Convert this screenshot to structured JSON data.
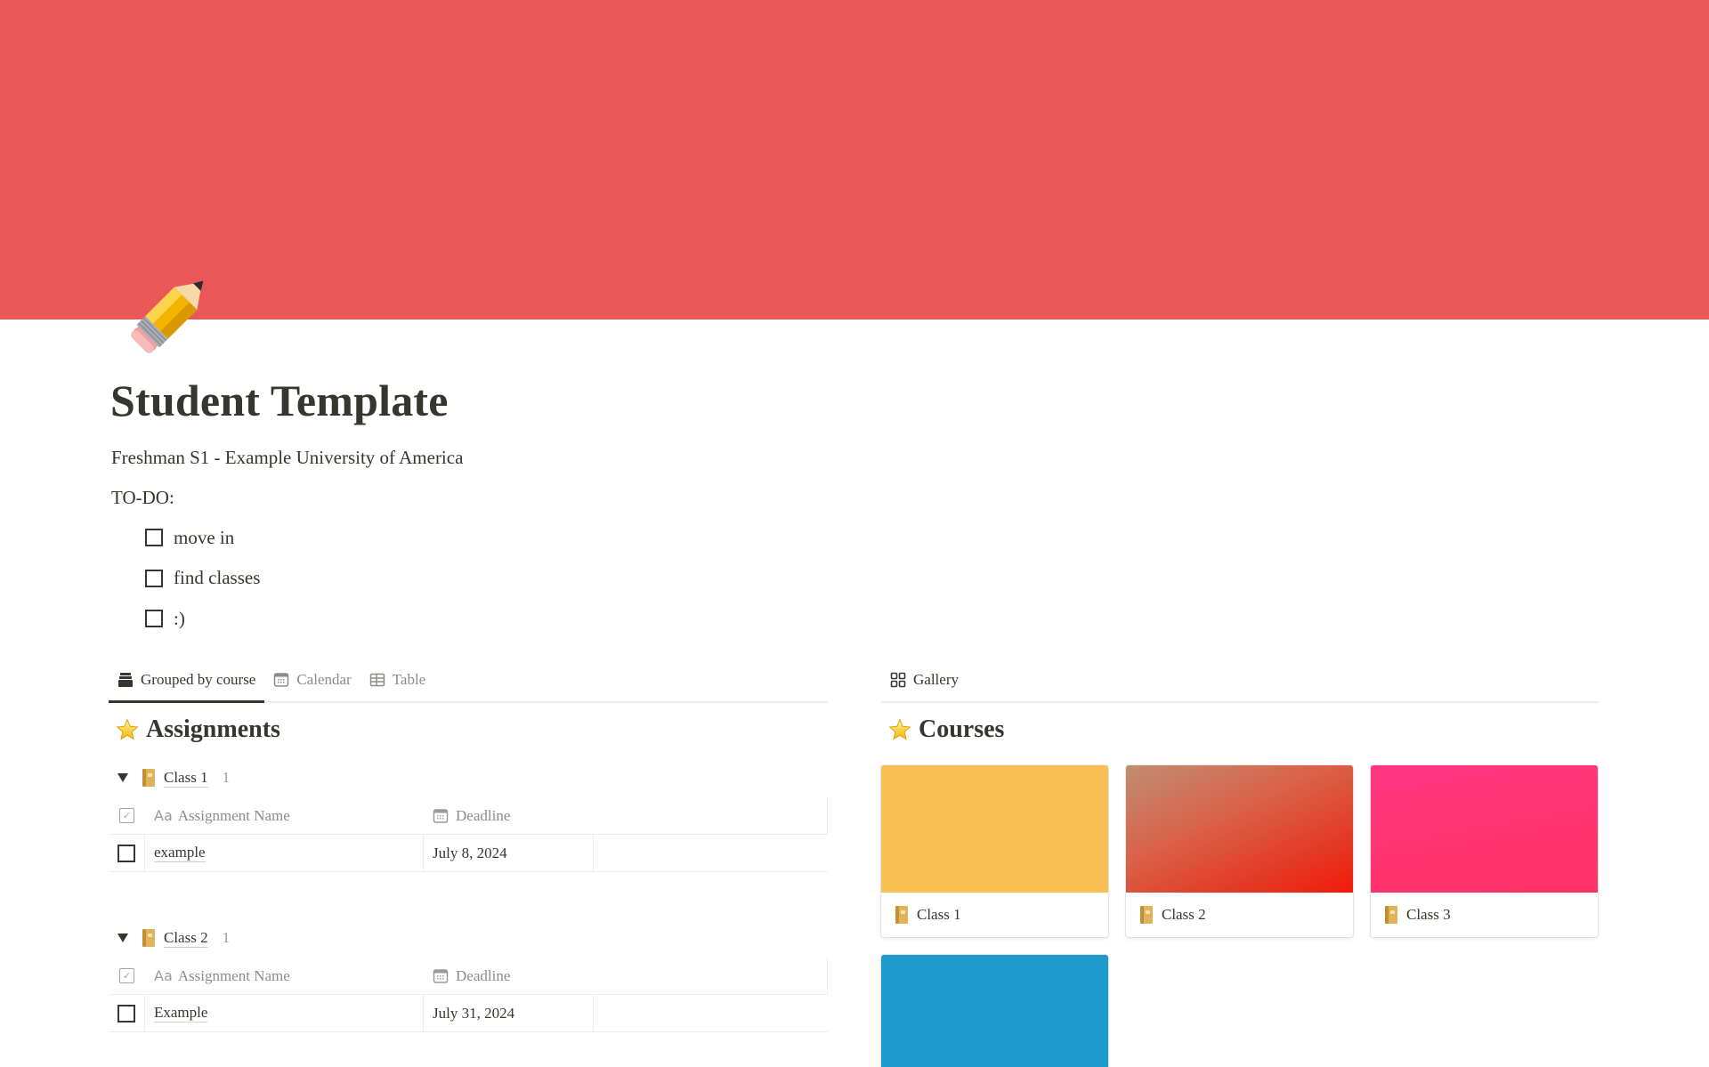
{
  "page": {
    "cover_color": "#eb5757",
    "icon": "pencil-emoji",
    "title": "Student Template",
    "subtitle": "Freshman S1 - Example University of America",
    "todo_label": "TO-DO:",
    "todos": [
      {
        "label": "move in",
        "checked": false
      },
      {
        "label": "find classes",
        "checked": false
      },
      {
        "label": ":)",
        "checked": false
      }
    ]
  },
  "assignments": {
    "tabs": [
      {
        "label": "Grouped by course",
        "icon": "stack-icon",
        "active": true
      },
      {
        "label": "Calendar",
        "icon": "calendar-icon",
        "active": false
      },
      {
        "label": "Table",
        "icon": "table-icon",
        "active": false
      }
    ],
    "title": "Assignments",
    "title_icon": "star-icon",
    "columns": {
      "name": "Assignment Name",
      "name_icon": "Aa",
      "deadline": "Deadline"
    },
    "groups": [
      {
        "name": "Class 1",
        "count": "1",
        "rows": [
          {
            "checked": false,
            "name": "example",
            "deadline": "July 8, 2024"
          }
        ]
      },
      {
        "name": "Class 2",
        "count": "1",
        "rows": [
          {
            "checked": false,
            "name": "Example",
            "deadline": "July 31, 2024"
          }
        ]
      }
    ]
  },
  "courses": {
    "tabs": [
      {
        "label": "Gallery",
        "icon": "gallery-icon",
        "active": true
      }
    ],
    "title": "Courses",
    "title_icon": "star-icon",
    "cards": [
      {
        "name": "Class 1",
        "cover": "#f8bf55"
      },
      {
        "name": "Class 2",
        "cover": "gradient-red-brown"
      },
      {
        "name": "Class 3",
        "cover": "#ff3680"
      },
      {
        "name": "",
        "cover": "#1e9acd"
      }
    ]
  }
}
